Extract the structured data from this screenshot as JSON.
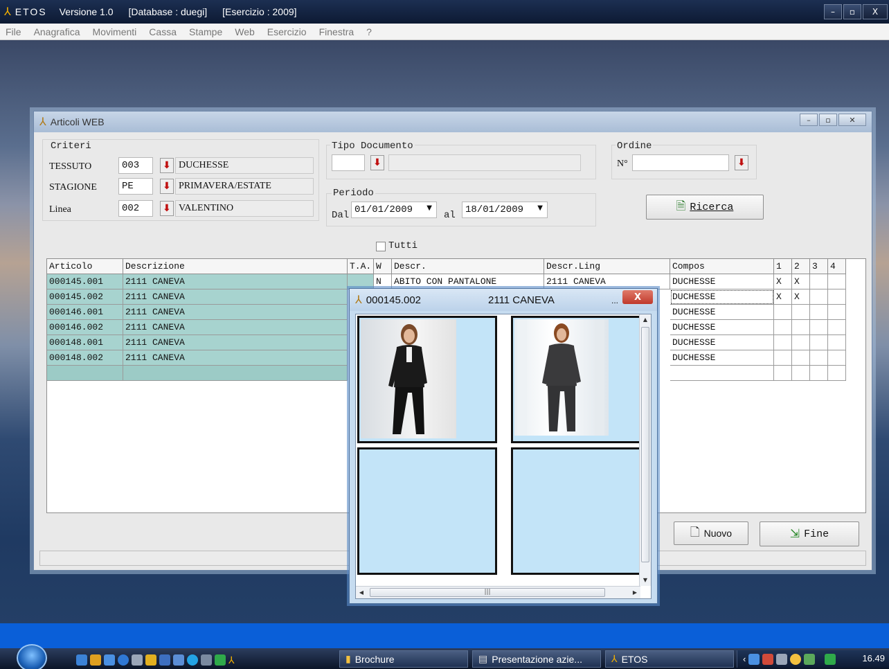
{
  "app": {
    "logo": "ETOS",
    "version": "Versione 1.0",
    "database": "[Database : duegi]",
    "esercizio": "[Esercizio : 2009]",
    "window_buttons": [
      "–",
      "▫",
      "X"
    ]
  },
  "menu": [
    "File",
    "Anagrafica",
    "Movimenti",
    "Cassa",
    "Stampe",
    "Web",
    "Esercizio",
    "Finestra",
    "?"
  ],
  "window": {
    "title": "Articoli WEB",
    "criteri": {
      "label": "Criteri",
      "rows": [
        {
          "label": "TESSUTO",
          "code": "003",
          "desc": "DUCHESSE"
        },
        {
          "label": "STAGIONE",
          "code": "PE",
          "desc": "PRIMAVERA/ESTATE"
        },
        {
          "label": "Linea",
          "code": "002",
          "desc": "VALENTINO"
        }
      ]
    },
    "tipo_documento": {
      "label": "Tipo Documento",
      "code": "",
      "desc": ""
    },
    "periodo": {
      "label": "Periodo",
      "dal_label": "Dal",
      "dal": "01/01/2009",
      "al_label": "al",
      "al": "18/01/2009"
    },
    "ordine": {
      "label": "Ordine",
      "n_label": "N°",
      "value": ""
    },
    "ricerca_label": "Ricerca",
    "tutti_label": "Tutti",
    "tutti_checked": false,
    "grid": {
      "columns": [
        "Articolo",
        "Descrizione",
        "T.A.",
        "W",
        "Descr.",
        "Descr.Ling",
        "Compos",
        "1",
        "2",
        "3",
        "4"
      ],
      "rows": [
        {
          "articolo": "000145.001",
          "descrizione": "2111 CANEVA",
          "w": "N",
          "descr": "ABITO CON PANTALONE",
          "descr_ling": "2111 CANEVA",
          "compos": "DUCHESSE",
          "c1": "X",
          "c2": "X"
        },
        {
          "articolo": "000145.002",
          "descrizione": "2111 CANEVA",
          "compos": "DUCHESSE",
          "c1": "X",
          "c2": "X"
        },
        {
          "articolo": "000146.001",
          "descrizione": "2111 CANEVA",
          "compos": "DUCHESSE"
        },
        {
          "articolo": "000146.002",
          "descrizione": "2111 CANEVA",
          "compos": "DUCHESSE"
        },
        {
          "articolo": "000148.001",
          "descrizione": "2111 CANEVA",
          "compos": "DUCHESSE"
        },
        {
          "articolo": "000148.002",
          "descrizione": "2111 CANEVA",
          "compos": "DUCHESSE"
        }
      ]
    },
    "nuovo_label": "Nuovo",
    "fine_label": "Fine"
  },
  "popup": {
    "code": "000145.002",
    "desc": "2111 CANEVA",
    "dots": "...",
    "close": "X"
  },
  "taskbar": {
    "tasks": [
      "Brochure",
      "Presentazione azie...",
      "ETOS"
    ],
    "clock": "16.49"
  },
  "colors": {
    "row_teal": "#a7d3cf",
    "image_cell_bg": "#c3e4f8",
    "dropdown_arrow": "#c01010"
  }
}
